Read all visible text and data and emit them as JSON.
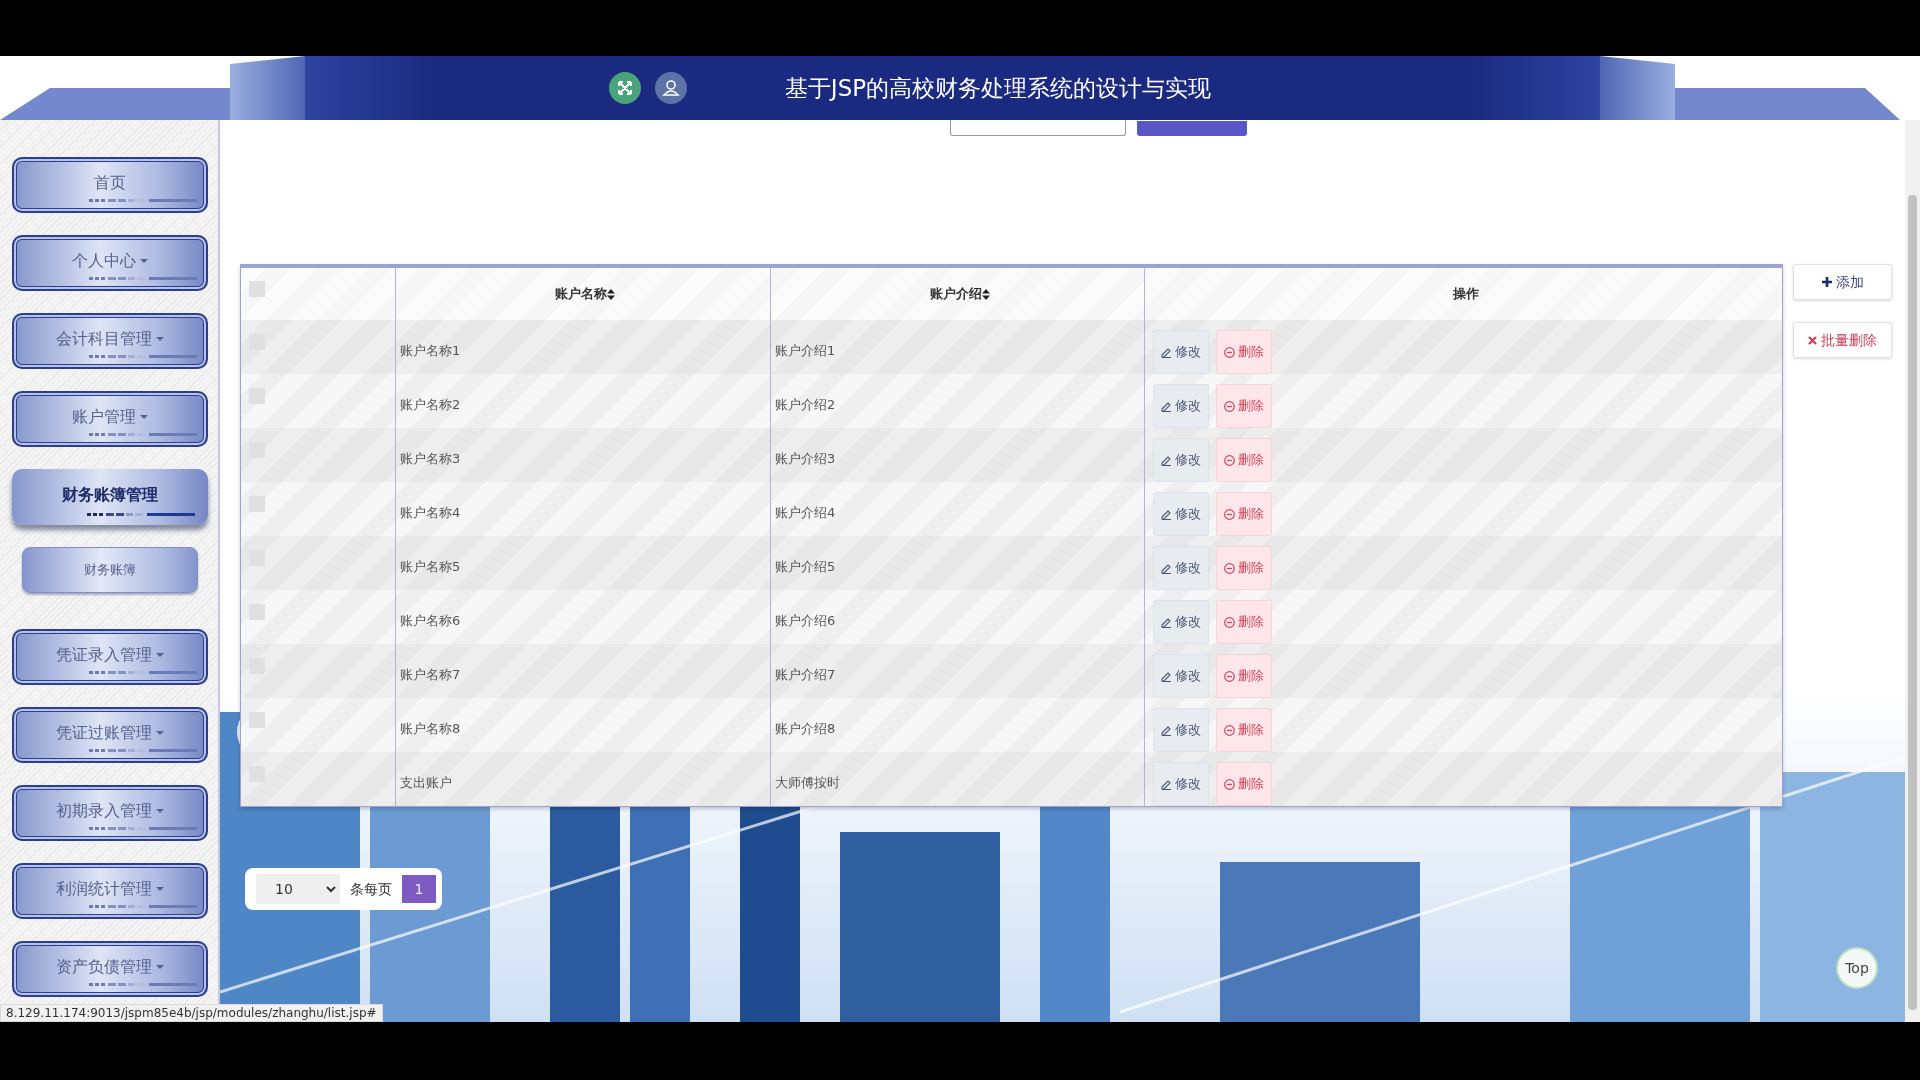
{
  "header": {
    "title": "基于JSP的高校财务处理系统的设计与实现"
  },
  "sidebar": {
    "items": [
      {
        "label": "首页",
        "has_menu": false,
        "selected": false
      },
      {
        "label": "个人中心",
        "has_menu": true,
        "selected": false
      },
      {
        "label": "会计科目管理",
        "has_menu": true,
        "selected": false
      },
      {
        "label": "账户管理",
        "has_menu": true,
        "selected": false
      },
      {
        "label": "财务账簿管理",
        "has_menu": false,
        "selected": true,
        "children": [
          {
            "label": "财务账簿"
          }
        ]
      },
      {
        "label": "凭证录入管理",
        "has_menu": true,
        "selected": false
      },
      {
        "label": "凭证过账管理",
        "has_menu": true,
        "selected": false
      },
      {
        "label": "初期录入管理",
        "has_menu": true,
        "selected": false
      },
      {
        "label": "利润统计管理",
        "has_menu": true,
        "selected": false
      },
      {
        "label": "资产负债管理",
        "has_menu": true,
        "selected": false
      }
    ]
  },
  "table": {
    "select_all_checked": false,
    "columns": [
      {
        "label": "账户名称",
        "sortable": true
      },
      {
        "label": "账户介绍",
        "sortable": true
      },
      {
        "label": "操作",
        "sortable": false
      }
    ],
    "rows": [
      {
        "checked": false,
        "name": "账户名称1",
        "intro": "账户介绍1",
        "actions": [
          "修改",
          "删除"
        ]
      },
      {
        "checked": false,
        "name": "账户名称2",
        "intro": "账户介绍2",
        "actions": [
          "修改",
          "删除"
        ]
      },
      {
        "checked": false,
        "name": "账户名称3",
        "intro": "账户介绍3",
        "actions": [
          "修改",
          "删除"
        ]
      },
      {
        "checked": false,
        "name": "账户名称4",
        "intro": "账户介绍4",
        "actions": [
          "修改",
          "删除"
        ]
      },
      {
        "checked": false,
        "name": "账户名称5",
        "intro": "账户介绍5",
        "actions": [
          "修改",
          "删除"
        ]
      },
      {
        "checked": false,
        "name": "账户名称6",
        "intro": "账户介绍6",
        "actions": [
          "修改",
          "删除"
        ]
      },
      {
        "checked": false,
        "name": "账户名称7",
        "intro": "账户介绍7",
        "actions": [
          "修改",
          "删除"
        ]
      },
      {
        "checked": false,
        "name": "账户名称8",
        "intro": "账户介绍8",
        "actions": [
          "修改",
          "删除"
        ]
      },
      {
        "checked": false,
        "name": "支出账户",
        "intro": "大师傅按时",
        "actions": [
          "修改",
          "删除"
        ]
      }
    ]
  },
  "side_buttons": [
    "添加",
    "批量删除"
  ],
  "pagination": {
    "page_size": "10",
    "page_size_label": "条每页",
    "pages": [
      {
        "label": "1",
        "selected": true
      }
    ]
  },
  "top_button": "Top",
  "status_bar": "8.129.11.174:9013/jspm85e4b/jsp/modules/zhanghu/list.jsp#"
}
